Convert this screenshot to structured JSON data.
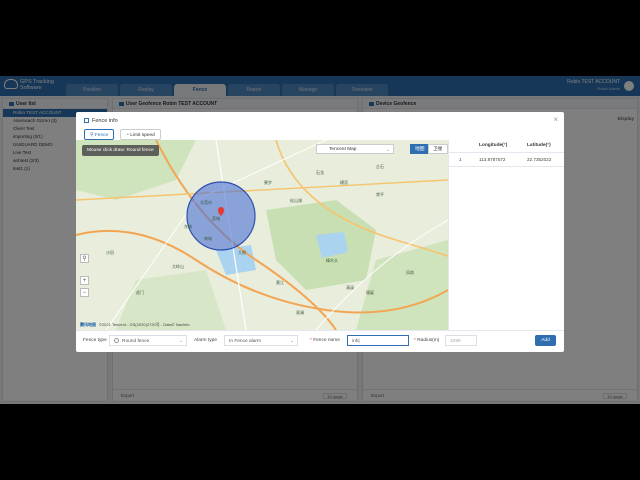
{
  "app": {
    "brand": "GPS Tracking Software",
    "account": "Robin TEST ACCOUNT",
    "account_sub": "Robin Admin"
  },
  "nav": [
    {
      "label": "Position",
      "icon": "location-icon"
    },
    {
      "label": "Replay",
      "icon": "replay-icon"
    },
    {
      "label": "Fence",
      "icon": "fence-icon"
    },
    {
      "label": "Report",
      "icon": "report-icon"
    },
    {
      "label": "Manage",
      "icon": "manage-icon"
    },
    {
      "label": "Overview",
      "icon": "overview-icon"
    }
  ],
  "left_panel": {
    "title": "User list",
    "items": [
      "Robin TEST ACCOUNT",
      "Aisenwach Gizmo (3)",
      "Client Test",
      "importing (0/1)",
      "UNIGUARD DEMO",
      "Live Test",
      "anhtest (2/3)",
      "test1 (1)"
    ]
  },
  "mid_panel": {
    "title": "User Geofence",
    "subtitle": "Robin TEST ACCOUNT",
    "export": "Export",
    "pager": "10 /page"
  },
  "right_panel": {
    "title": "Device Geofence",
    "column": "Display",
    "search": "Search IMEI/Di",
    "export": "Export",
    "pager": "10 /page"
  },
  "modal": {
    "title": "Fence info",
    "tabs": [
      "Fence",
      "Limit speed"
    ],
    "tooltip": "Mouse click draw: Round fence",
    "map_provider": "Tencent Map",
    "map_modes": [
      "地图",
      "卫星"
    ],
    "map_credit_logo": "腾讯地图",
    "map_credit": "©2021 Tencent - GS(2020)2720号 - Data© NavInfo",
    "map_labels": [
      "东莞市",
      "松山湖",
      "大朗",
      "石龙",
      "常平",
      "大岭山",
      "寮步",
      "企石",
      "横沥",
      "樟木头",
      "塘厦",
      "虎门",
      "黄江",
      "清溪",
      "凤岗",
      "观澜",
      "东城",
      "南城",
      "沙田",
      "莞城"
    ],
    "table": {
      "headers": [
        "Longitude(°)",
        "Latitude(°)"
      ],
      "rows": [
        [
          "1",
          "113.8787572",
          "22.7352022"
        ]
      ]
    },
    "form": {
      "fence_type_label": "Fence type",
      "fence_type_value": "Round fence",
      "alarm_type_label": "Alarm type",
      "alarm_type_value": "In Fence alarm",
      "fence_name_label": "Fence name",
      "fence_name_value": "inh|",
      "radius_label": "Radius(m)",
      "radius_value": "3398",
      "add_label": "Add"
    }
  },
  "colors": {
    "primary": "#2f6fb0",
    "fence_fill": "#4a6fd6"
  }
}
